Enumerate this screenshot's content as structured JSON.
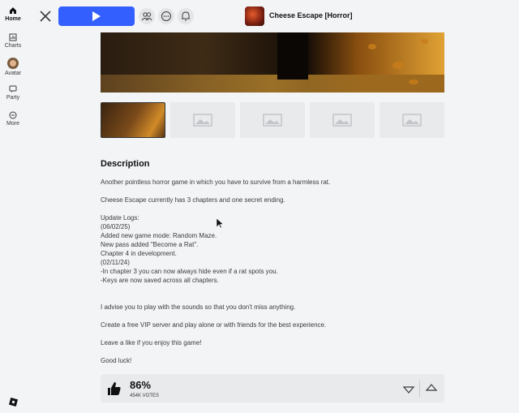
{
  "sidebar": {
    "items": [
      {
        "label": "Home",
        "icon": "home-icon"
      },
      {
        "label": "Charts",
        "icon": "charts-icon"
      },
      {
        "label": "Avatar",
        "icon": "avatar-icon"
      },
      {
        "label": "Party",
        "icon": "party-icon"
      },
      {
        "label": "More",
        "icon": "more-icon"
      }
    ]
  },
  "header": {
    "game_title": "Cheese Escape [Horror]",
    "icons": [
      "close-icon",
      "play-icon",
      "friends-icon",
      "chat-icon",
      "bell-icon"
    ],
    "accent": "#335fff"
  },
  "description": {
    "heading": "Description",
    "lines": [
      "Another pointless horror game in which you have to survive from a harmless rat.",
      "Cheese Escape currently has 3 chapters and one secret ending.",
      "Update Logs:",
      "(06/02/25)",
      "Added new game mode: Random Maze.",
      "New pass added \"Become a Rat\".",
      "Chapter 4 in development.",
      "(02/11/24)",
      "-In chapter 3 you can now always hide even if a rat spots you.",
      "-Keys are now saved across all chapters.",
      "I advise you to play with the sounds so that you don't miss anything.",
      "Create a free VIP server and play alone or with friends for the best experience.",
      "Leave a like if you enjoy this game!",
      "Good luck!"
    ]
  },
  "votes": {
    "percent": "86%",
    "count": "454K VOTES"
  }
}
